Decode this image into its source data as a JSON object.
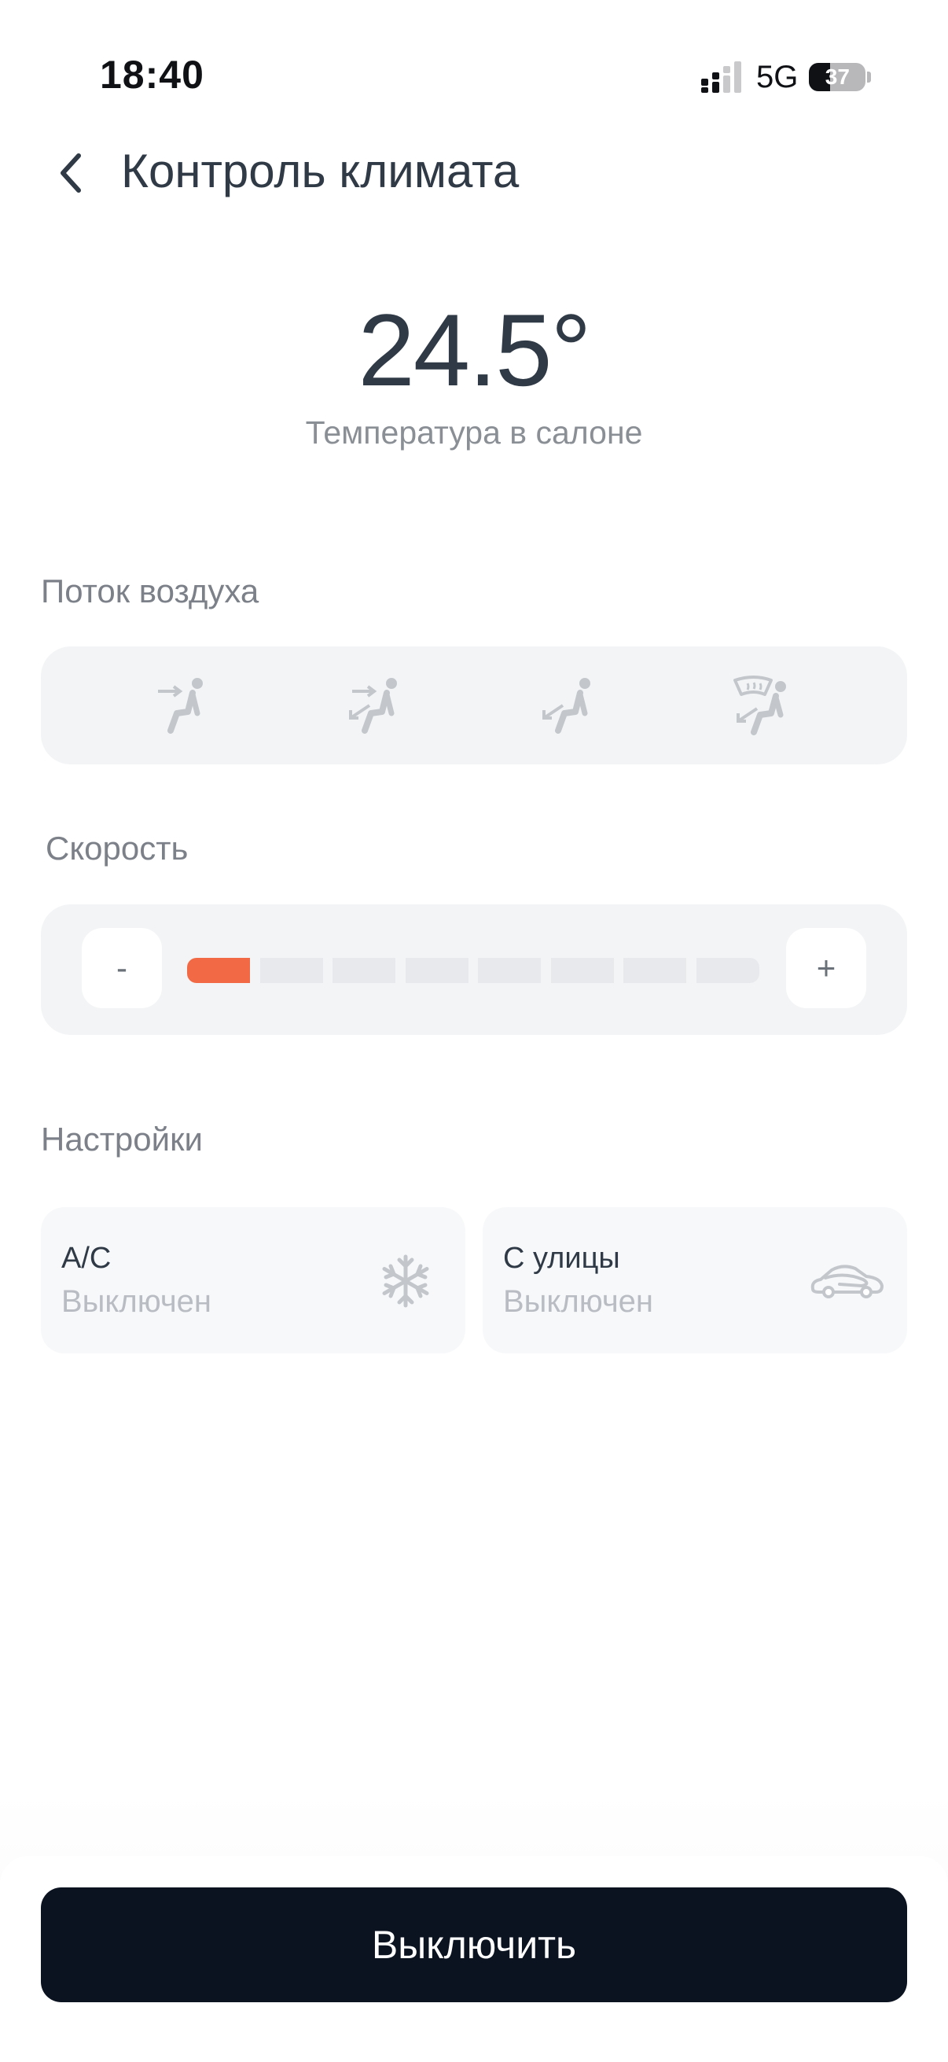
{
  "status_bar": {
    "time": "18:40",
    "network": "5G",
    "battery": "37"
  },
  "header": {
    "title": "Контроль климата"
  },
  "temperature": {
    "value": "24.5°",
    "label": "Температура в салоне"
  },
  "airflow": {
    "label": "Поток воздуха",
    "modes": [
      "face-airflow-icon",
      "face-feet-airflow-icon",
      "feet-airflow-icon",
      "feet-windshield-airflow-icon"
    ]
  },
  "speed": {
    "label": "Скорость",
    "minus": "-",
    "plus": "+",
    "level": 1,
    "max_level": 8
  },
  "settings": {
    "label": "Настройки",
    "ac": {
      "title": "A/C",
      "status": "Выключен",
      "icon": "snowflake-icon"
    },
    "recirculation": {
      "title": "С улицы",
      "status": "Выключен",
      "icon": "car-airflow-icon"
    }
  },
  "footer": {
    "button_label": "Выключить"
  },
  "colors": {
    "accent": "#f26a45",
    "text_primary": "#2f3a46",
    "text_secondary": "#7c8189",
    "panel_bg": "#f3f4f6",
    "button_dark": "#0b1220"
  }
}
